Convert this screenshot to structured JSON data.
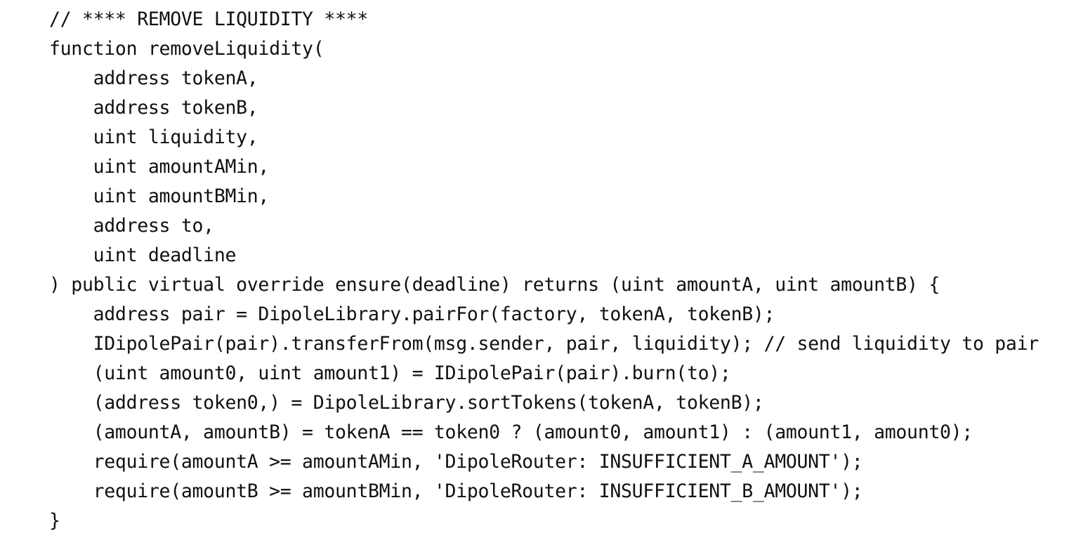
{
  "code": {
    "lines": [
      "// **** REMOVE LIQUIDITY ****",
      "function removeLiquidity(",
      "    address tokenA,",
      "    address tokenB,",
      "    uint liquidity,",
      "    uint amountAMin,",
      "    uint amountBMin,",
      "    address to,",
      "    uint deadline",
      ") public virtual override ensure(deadline) returns (uint amountA, uint amountB) {",
      "    address pair = DipoleLibrary.pairFor(factory, tokenA, tokenB);",
      "    IDipolePair(pair).transferFrom(msg.sender, pair, liquidity); // send liquidity to pair",
      "    (uint amount0, uint amount1) = IDipolePair(pair).burn(to);",
      "    (address token0,) = DipoleLibrary.sortTokens(tokenA, tokenB);",
      "    (amountA, amountB) = tokenA == token0 ? (amount0, amount1) : (amount1, amount0);",
      "    require(amountA >= amountAMin, 'DipoleRouter: INSUFFICIENT_A_AMOUNT');",
      "    require(amountB >= amountBMin, 'DipoleRouter: INSUFFICIENT_B_AMOUNT');",
      "}"
    ]
  }
}
